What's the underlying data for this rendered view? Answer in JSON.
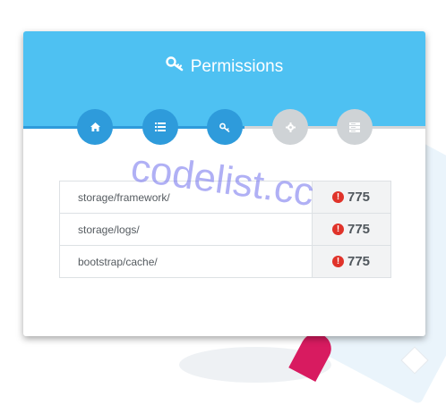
{
  "header": {
    "title": "Permissions",
    "icon": "key-icon",
    "background_color": "#4ec1f2"
  },
  "steps": [
    {
      "icon": "home-icon",
      "state": "active"
    },
    {
      "icon": "list-icon",
      "state": "active"
    },
    {
      "icon": "key-icon",
      "state": "active"
    },
    {
      "icon": "gear-icon",
      "state": "inactive"
    },
    {
      "icon": "server-icon",
      "state": "inactive"
    }
  ],
  "colors": {
    "active_step": "#2e9bdb",
    "inactive_step": "#cfd3d6",
    "error": "#e0332a"
  },
  "permissions": [
    {
      "path": "storage/framework/",
      "status_icon": "error-icon",
      "code": "775"
    },
    {
      "path": "storage/logs/",
      "status_icon": "error-icon",
      "code": "775"
    },
    {
      "path": "bootstrap/cache/",
      "status_icon": "error-icon",
      "code": "775"
    }
  ],
  "watermark": "codelist.cc"
}
